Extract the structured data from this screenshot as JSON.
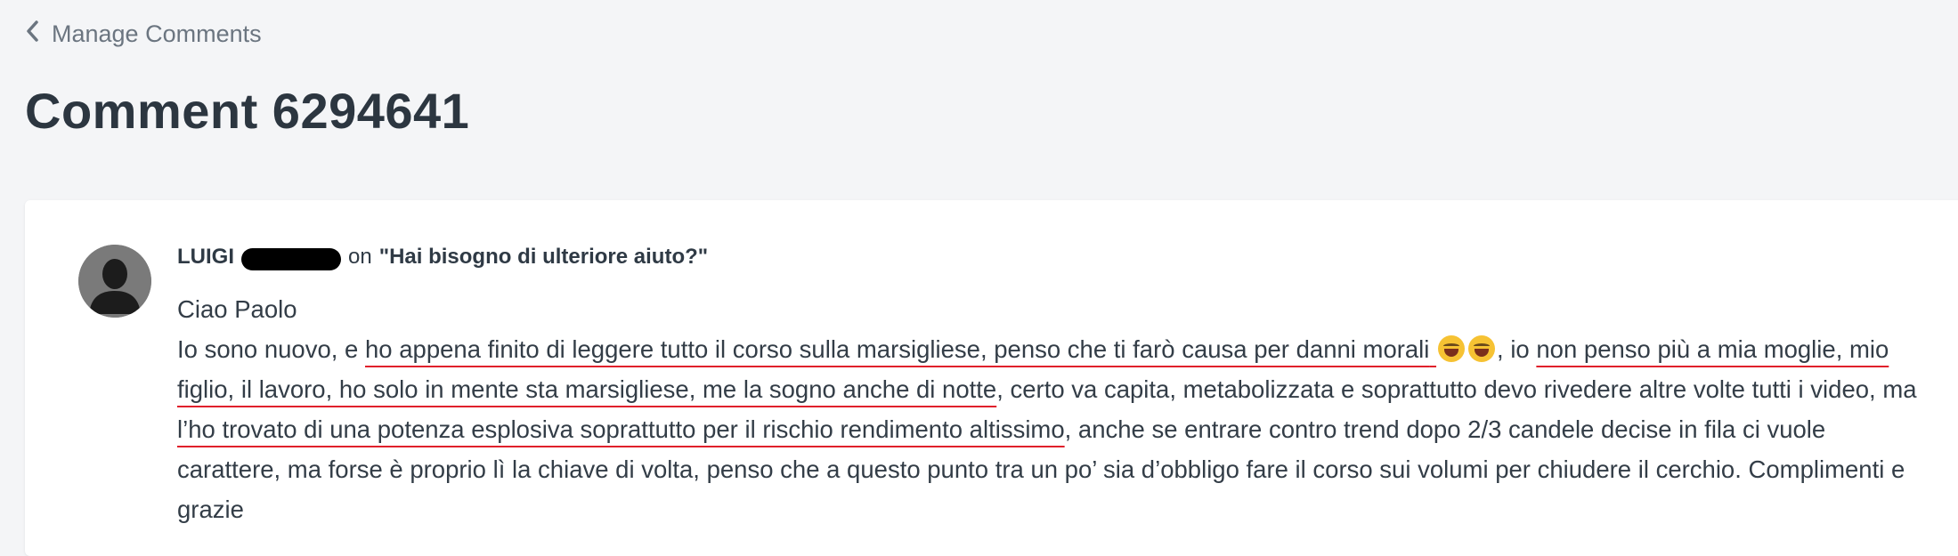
{
  "nav": {
    "back_label": "Manage Comments"
  },
  "page": {
    "title": "Comment 6294641"
  },
  "comment": {
    "author": "LUIGI",
    "on_word": "on",
    "thread_title": "\"Hai bisogno di ulteriore aiuto?\"",
    "greeting": "Ciao Paolo",
    "segments": {
      "s1": "Io sono nuovo, e ",
      "s2": "ho appena finito di leggere tutto il corso sulla marsigliese, penso che ti farò causa per danni morali",
      "s3": ", io ",
      "s4": "non penso più a mia moglie, mio figlio, il lavoro, ho solo in mente sta marsigliese, me la sogno anche di notte",
      "s5": ", certo va capita, metabolizzata e soprattutto devo rivedere altre volte tutti i video, ma ",
      "s6": "l’ho trovato di una potenza esplosiva soprattutto per il rischio rendimento altissimo",
      "s7": ", anche se entrare contro trend dopo 2/3 candele decise in fila ci vuole carattere, ma forse è proprio lì la chiave di volta, penso che a questo punto tra un po’ sia d’obbligo fare il corso sui volumi per chiudere il cerchio. Complimenti e grazie"
    },
    "emoji_icons": [
      "laughing-emoji-icon",
      "laughing-emoji-icon"
    ],
    "highlight_color": "#e0202b"
  }
}
